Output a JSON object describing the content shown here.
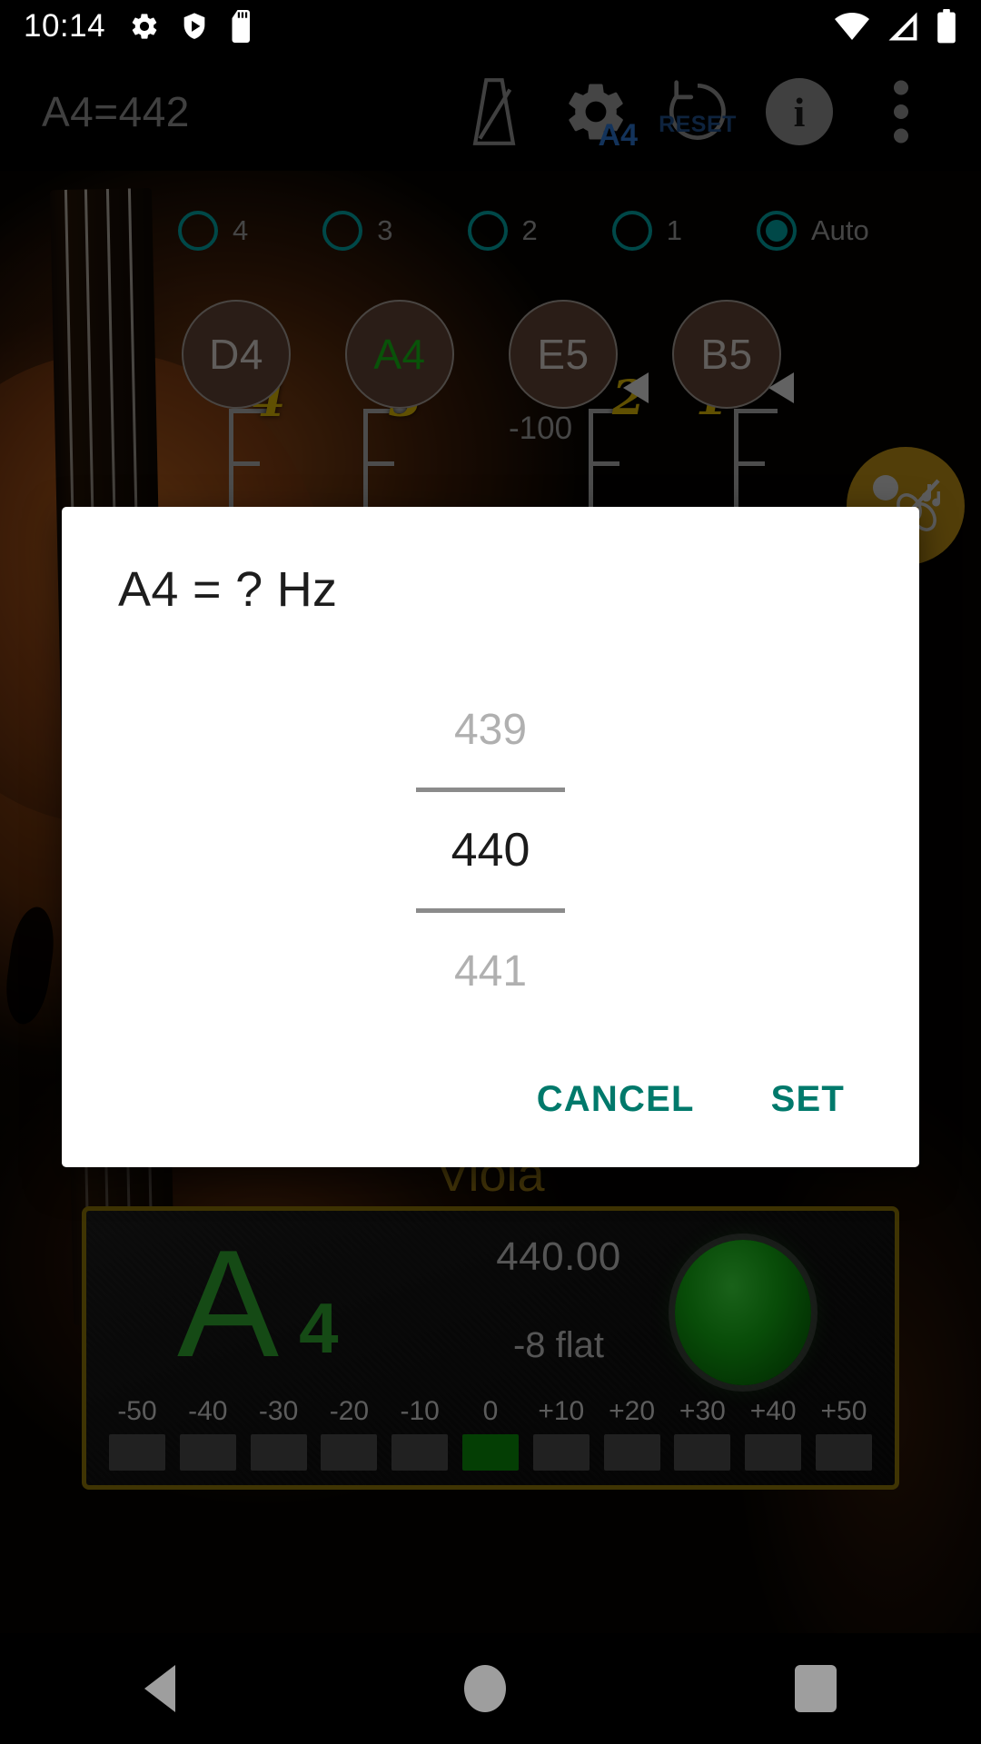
{
  "status_bar": {
    "clock": "10:14",
    "left_icons": [
      "gear-icon",
      "play-protect-shield-icon",
      "sd-card-icon"
    ],
    "right_icons": [
      "wifi-icon",
      "cellular-signal-icon",
      "battery-icon"
    ]
  },
  "app_bar": {
    "title": "A4=442",
    "actions": [
      {
        "name": "metronome-icon",
        "label": ""
      },
      {
        "name": "settings-a4-icon",
        "label": "A4"
      },
      {
        "name": "reset-icon",
        "label": "RESET"
      },
      {
        "name": "info-icon",
        "label": "i"
      },
      {
        "name": "overflow-menu-icon",
        "label": ""
      }
    ]
  },
  "string_selector": {
    "options": [
      {
        "label": "4",
        "selected": false
      },
      {
        "label": "3",
        "selected": false
      },
      {
        "label": "2",
        "selected": false
      },
      {
        "label": "1",
        "selected": false
      },
      {
        "label": "Auto",
        "selected": true
      }
    ],
    "accent_color": "#00a0a0"
  },
  "note_buttons": [
    {
      "label": "D4",
      "active": false
    },
    {
      "label": "A4",
      "active": true
    },
    {
      "label": "E5",
      "active": false
    },
    {
      "label": "B5",
      "active": false
    }
  ],
  "pegs": {
    "numbers": [
      "4",
      "3",
      "2",
      "1"
    ],
    "cents_min_label": "-100"
  },
  "fab": {
    "name": "musician-violin-icon"
  },
  "instrument": {
    "label": "Viola"
  },
  "tuner": {
    "note_letter": "A",
    "note_octave": "4",
    "frequency": "440.00",
    "deviation": "-8 flat",
    "lamp_color": "#13a913",
    "cents_labels": [
      "-50",
      "-40",
      "-30",
      "-20",
      "-10",
      "0",
      "+10",
      "+20",
      "+30",
      "+40",
      "+50"
    ],
    "lit_index": 5,
    "lit_color": "#0a8a0a",
    "border_color": "#8d7408"
  },
  "dialog": {
    "title": "A4 = ? Hz",
    "picker": {
      "previous": "439",
      "selected": "440",
      "next": "441"
    },
    "cancel_label": "CANCEL",
    "set_label": "SET",
    "accent_color": "#00796b"
  },
  "nav_bar": {
    "back": "back-icon",
    "home": "home-icon",
    "recents": "recents-icon"
  }
}
